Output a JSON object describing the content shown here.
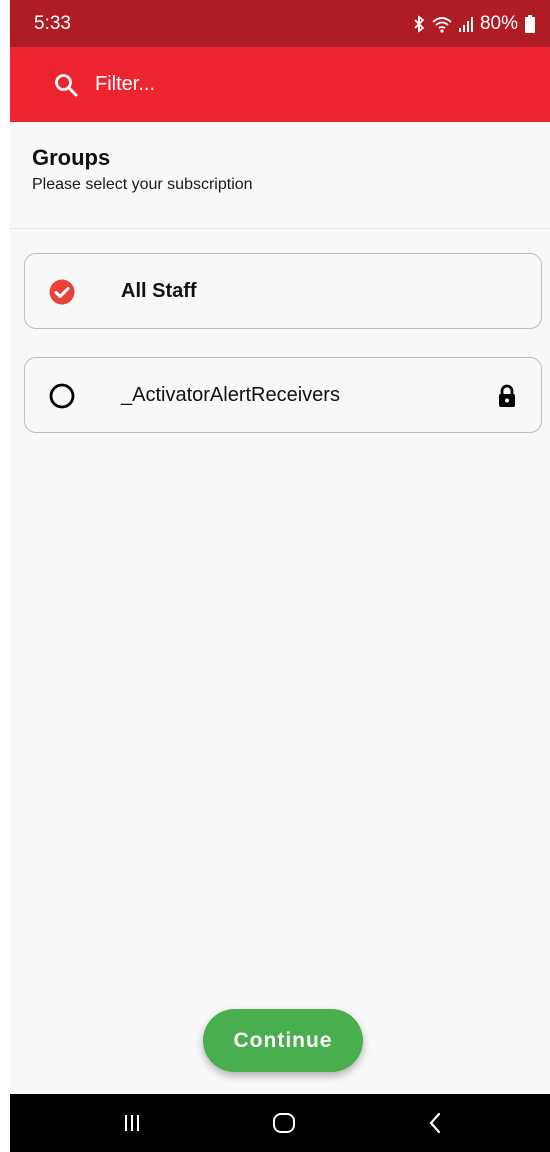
{
  "status_bar": {
    "time": "5:33",
    "battery": "80%",
    "icons": [
      "bluetooth-icon",
      "wifi-icon",
      "signal-icon",
      "battery-icon"
    ]
  },
  "toolbar": {
    "search_icon": "search-icon",
    "filter_placeholder": "Filter..."
  },
  "header": {
    "title": "Groups",
    "subtitle": "Please select your subscription"
  },
  "groups": [
    {
      "name": "All Staff",
      "selected": true,
      "locked": false
    },
    {
      "name": "_ActivatorAlertReceivers",
      "selected": false,
      "locked": true
    }
  ],
  "continue_label": "Continue",
  "nav_bar": {
    "icons": [
      "recent-apps-icon",
      "home-icon",
      "back-icon"
    ]
  },
  "colors": {
    "status_bar": "#b01c24",
    "toolbar": "#ee2530",
    "accent_check": "#e8423a",
    "continue": "#48ae4e",
    "background": "#f8f8f8"
  }
}
